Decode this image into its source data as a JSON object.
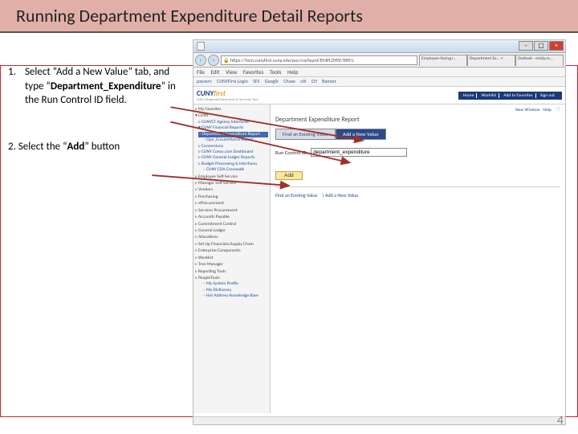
{
  "title": "Running Department Expenditure Detail Reports",
  "instructions": {
    "step1_num": "1.",
    "step1_pre": "Select “Add a New Value” tab, and type “",
    "step1_bold": "Department_Expenditure",
    "step1_post": "” in the Run Control ID field.",
    "step2_pre": "2. Select the “",
    "step2_bold": "Add",
    "step2_post": "” button"
  },
  "browser": {
    "url": "https://hcm.cunyfirst.cuny.edu/psc/cnyhcprd/EMPLOYEE/ERP/c",
    "tabs": [
      "Employee-facing r...",
      "Department Ex... ×",
      "Outlook - emily.m..."
    ],
    "menu": [
      "File",
      "Edit",
      "View",
      "Favorites",
      "Tools",
      "Help"
    ],
    "favorites": [
      "payserv",
      "CUNYFirst Login",
      "SFS",
      "Google",
      "Chase",
      "citi",
      "CH",
      "Banner"
    ],
    "win_close": "×",
    "back": "‹",
    "fwd": "›"
  },
  "cuny": {
    "logo_main": "CUNY",
    "logo_first": "first",
    "logo_sub": "Fully Integrated Resources & Services Tool",
    "top_links": [
      "Home",
      "Worklist",
      "Add to Favorites",
      "Sign out"
    ],
    "top_actions": [
      "New Window",
      "Help"
    ],
    "nav": {
      "myfav": "▹ My Favorites",
      "cuny": "▾ CUNY",
      "ai": "▹ CUNYCF Agency Interfaces",
      "fr": "▾ CUNY Financial Reports",
      "de": "– Department Expenditure Report",
      "oem": "– Opn_EncumMatrix Report",
      "conv": "▹ Conversions",
      "cd": "▹ CUNY Coeus.com Dashboard",
      "gl": "▹ CUNY General Ledger Reports",
      "bpi": "▹ Budget Processing & Interfaces",
      "coa": "– CUNY COA Crosswalk",
      "ess": "▹ Employee Self-Service",
      "mss": "▹ Manager Self-Service",
      "ven": "▹ Vendors",
      "pur": "▹ Purchasing",
      "epr": "▹ eProcurement",
      "sp": "▹ Services Procurement",
      "ap": "▹ Accounts Payable",
      "cc": "▹ Commitment Control",
      "gl2": "▹ General Ledger",
      "al": "▹ Allocations",
      "sfsc": "▹ Set Up Financials/Supply Chain",
      "ec": "▹ Enterprise Components",
      "wl": "▹ Worklist",
      "tm": "▹ Tree Manager",
      "rt": "▹ Reporting Tools",
      "pt": "▹ PeopleTools",
      "msp": "– My System Profile",
      "md": "– My Dictionary",
      "nkb": "– Hot Address Knowledge Base"
    },
    "page_heading": "Department Expenditure Report",
    "tab_find": "Find an Existing Value",
    "tab_add": "Add a New Value",
    "field_label": "Run Control ID:",
    "field_value": "department_expenditure",
    "add_button": "Add",
    "bottom_find": "Find an Existing Value",
    "bottom_sep": " | ",
    "bottom_add": "Add a New Value"
  },
  "page_number": "4"
}
